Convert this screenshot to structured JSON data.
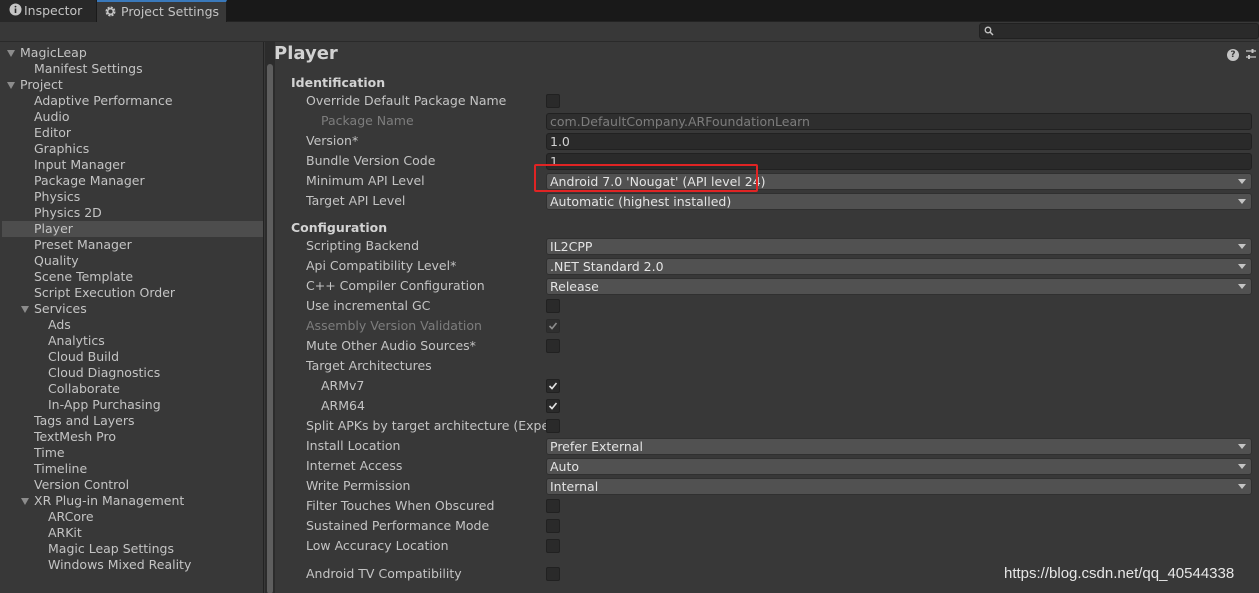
{
  "tabs": [
    {
      "label": "Inspector",
      "icon": "info-icon"
    },
    {
      "label": "Project Settings",
      "icon": "gear-icon"
    }
  ],
  "sidebar": {
    "items": [
      {
        "label": "MagicLeap",
        "level": 0,
        "expanded": true
      },
      {
        "label": "Manifest Settings",
        "level": 1
      },
      {
        "label": "Project",
        "level": 0,
        "expanded": true
      },
      {
        "label": "Adaptive Performance",
        "level": 1
      },
      {
        "label": "Audio",
        "level": 1
      },
      {
        "label": "Editor",
        "level": 1
      },
      {
        "label": "Graphics",
        "level": 1
      },
      {
        "label": "Input Manager",
        "level": 1
      },
      {
        "label": "Package Manager",
        "level": 1
      },
      {
        "label": "Physics",
        "level": 1
      },
      {
        "label": "Physics 2D",
        "level": 1
      },
      {
        "label": "Player",
        "level": 1,
        "selected": true
      },
      {
        "label": "Preset Manager",
        "level": 1
      },
      {
        "label": "Quality",
        "level": 1
      },
      {
        "label": "Scene Template",
        "level": 1
      },
      {
        "label": "Script Execution Order",
        "level": 1
      },
      {
        "label": "Services",
        "level": 1,
        "expanded": true
      },
      {
        "label": "Ads",
        "level": 2
      },
      {
        "label": "Analytics",
        "level": 2
      },
      {
        "label": "Cloud Build",
        "level": 2
      },
      {
        "label": "Cloud Diagnostics",
        "level": 2
      },
      {
        "label": "Collaborate",
        "level": 2
      },
      {
        "label": "In-App Purchasing",
        "level": 2
      },
      {
        "label": "Tags and Layers",
        "level": 1
      },
      {
        "label": "TextMesh Pro",
        "level": 1
      },
      {
        "label": "Time",
        "level": 1
      },
      {
        "label": "Timeline",
        "level": 1
      },
      {
        "label": "Version Control",
        "level": 1
      },
      {
        "label": "XR Plug-in Management",
        "level": 1,
        "expanded": true
      },
      {
        "label": "ARCore",
        "level": 2
      },
      {
        "label": "ARKit",
        "level": 2
      },
      {
        "label": "Magic Leap Settings",
        "level": 2
      },
      {
        "label": "Windows Mixed Reality",
        "level": 2
      }
    ]
  },
  "panel": {
    "title": "Player",
    "identification": {
      "heading": "Identification",
      "override_label": "Override Default Package Name",
      "override_checked": false,
      "package_name_label": "Package Name",
      "package_name_value": "com.DefaultCompany.ARFoundationLearn",
      "version_label": "Version*",
      "version_value": "1.0",
      "bundle_label": "Bundle Version Code",
      "bundle_value": "1",
      "min_api_label": "Minimum API Level",
      "min_api_value": "Android 7.0 'Nougat' (API level 24)",
      "target_api_label": "Target API Level",
      "target_api_value": "Automatic (highest installed)"
    },
    "configuration": {
      "heading": "Configuration",
      "scripting_label": "Scripting Backend",
      "scripting_value": "IL2CPP",
      "api_compat_label": "Api Compatibility Level*",
      "api_compat_value": ".NET Standard 2.0",
      "cpp_label": "C++ Compiler Configuration",
      "cpp_value": "Release",
      "incgc_label": "Use incremental GC",
      "incgc_checked": false,
      "asmver_label": "Assembly Version Validation",
      "asmver_checked": true,
      "mute_label": "Mute Other Audio Sources*",
      "mute_checked": false,
      "archs_label": "Target Architectures",
      "armv7_label": "ARMv7",
      "armv7_checked": true,
      "arm64_label": "ARM64",
      "arm64_checked": true,
      "split_label": "Split APKs by target architecture (Experime",
      "split_checked": false,
      "install_label": "Install Location",
      "install_value": "Prefer External",
      "internet_label": "Internet Access",
      "internet_value": "Auto",
      "write_label": "Write Permission",
      "write_value": "Internal",
      "filter_label": "Filter Touches When Obscured",
      "filter_checked": false,
      "sustained_label": "Sustained Performance Mode",
      "sustained_checked": false,
      "lowacc_label": "Low Accuracy Location",
      "lowacc_checked": false,
      "androidtv_label": "Android TV Compatibility",
      "androidtv_checked": false
    }
  },
  "watermark": "https://blog.csdn.net/qq_40544338",
  "colors": {
    "highlight_box": "#e02424",
    "selected_row": "#4d4d4d",
    "active_tab_accent": "#3a79bb"
  }
}
